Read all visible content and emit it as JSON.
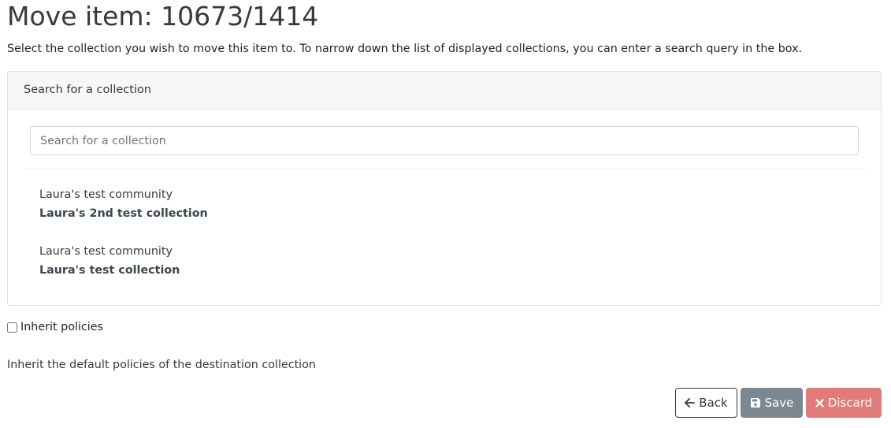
{
  "page": {
    "title": "Move item: 10673/1414",
    "intro": "Select the collection you wish to move this item to. To narrow down the list of displayed collections, you can enter a search query in the box."
  },
  "search_card": {
    "header": "Search for a collection",
    "input_value": "",
    "input_placeholder": "Search for a collection",
    "results": [
      {
        "community": "Laura's test community",
        "collection": "Laura's 2nd test collection"
      },
      {
        "community": "Laura's test community",
        "collection": "Laura's test collection"
      }
    ]
  },
  "inherit": {
    "label": "Inherit policies",
    "checked": false,
    "help": "Inherit the default policies of the destination collection"
  },
  "buttons": {
    "back": {
      "label": "Back",
      "icon": "arrow-left-icon"
    },
    "save": {
      "label": "Save",
      "icon": "save-icon"
    },
    "discard": {
      "label": "Discard",
      "icon": "close-icon"
    }
  },
  "colors": {
    "save_bg": "#7d8790",
    "discard_bg": "#e07b7a",
    "card_header_bg": "#f7f7f7"
  }
}
